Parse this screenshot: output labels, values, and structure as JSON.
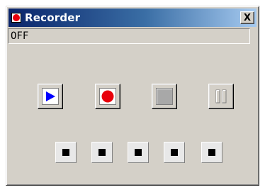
{
  "window": {
    "title": "Recorder",
    "close_label": "X",
    "icon": "record-dot-icon"
  },
  "status": {
    "value": "OFF"
  },
  "controls": [
    {
      "name": "play",
      "icon": "play-icon"
    },
    {
      "name": "record",
      "icon": "record-icon"
    },
    {
      "name": "stop",
      "icon": "stop-icon"
    },
    {
      "name": "pause",
      "icon": "pause-icon"
    }
  ],
  "slots": [
    {
      "icon": "square-icon"
    },
    {
      "icon": "square-icon"
    },
    {
      "icon": "square-icon"
    },
    {
      "icon": "square-icon"
    },
    {
      "icon": "square-icon"
    }
  ],
  "colors": {
    "title_bar_start": "#0a246a",
    "title_bar_end": "#a6caf0",
    "record_red": "#e8000b",
    "play_blue": "#0000ff",
    "window_face": "#d4d0c8"
  }
}
